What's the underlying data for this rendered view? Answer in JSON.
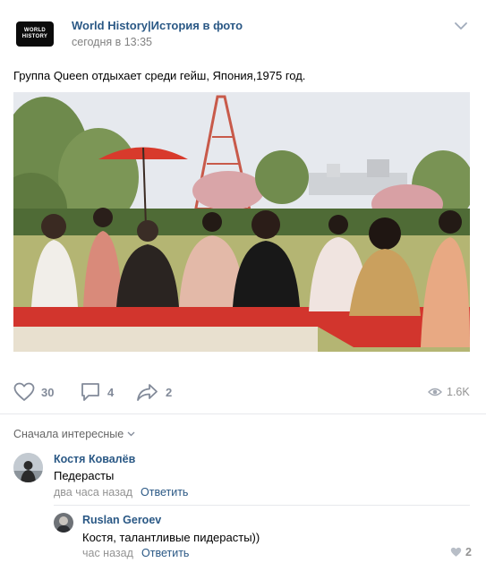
{
  "post": {
    "logo_line1": "WORLD",
    "logo_line2": "HISTORY",
    "author": "World History|История в фото",
    "time": "сегодня в 13:35",
    "text": "Группа Queen отдыхает среди гейш, Япония,1975 год.",
    "photo_icon": "photo-image",
    "likes": "30",
    "comments": "4",
    "shares": "2",
    "views": "1.6K"
  },
  "comments_section": {
    "sort_label": "Сначала интересные",
    "items": [
      {
        "name": "Костя Ковалёв",
        "text": "Педерасты",
        "time": "два часа назад",
        "reply_label": "Ответить"
      },
      {
        "name": "Ruslan Geroev",
        "text": "Костя, талантливые пидерасты))",
        "time": "час назад",
        "reply_label": "Ответить",
        "likes": "2"
      }
    ]
  },
  "colors": {
    "link": "#2a5885",
    "muted": "#828a99",
    "divider": "#e7e8ec"
  }
}
